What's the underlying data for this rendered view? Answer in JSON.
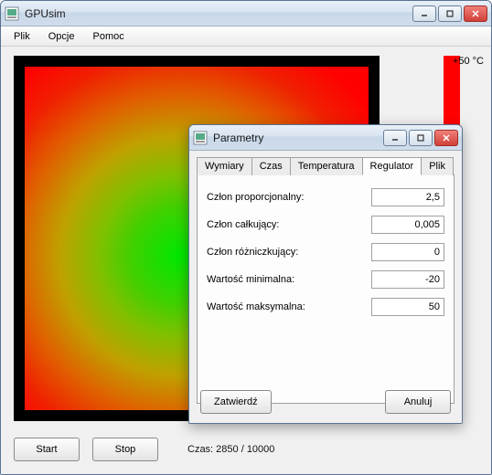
{
  "main_window": {
    "title": "GPUsim",
    "menu": {
      "file": "Plik",
      "options": "Opcje",
      "help": "Pomoc"
    },
    "temp_max_label": "+50 °C",
    "start_label": "Start",
    "stop_label": "Stop",
    "status_text": "Czas: 2850 / 10000"
  },
  "param_window": {
    "title": "Parametry",
    "tabs": {
      "dimensions": "Wymiary",
      "time": "Czas",
      "temperature": "Temperatura",
      "regulator": "Regulator",
      "file": "Plik"
    },
    "fields": {
      "kp": {
        "label": "Człon proporcjonalny:",
        "value": "2,5"
      },
      "ki": {
        "label": "Człon całkujący:",
        "value": "0,005"
      },
      "kd": {
        "label": "Człon różniczkujący:",
        "value": "0"
      },
      "min": {
        "label": "Wartość minimalna:",
        "value": "-20"
      },
      "max": {
        "label": "Wartość maksymalna:",
        "value": "50"
      }
    },
    "ok_label": "Zatwierdź",
    "cancel_label": "Anuluj"
  }
}
